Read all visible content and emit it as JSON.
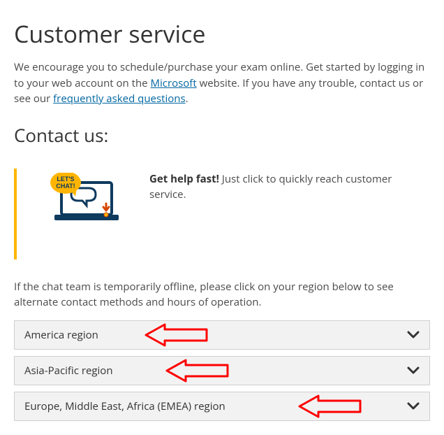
{
  "page": {
    "title": "Customer service",
    "intro_prefix": "We encourage you to schedule/purchase your exam online. Get started by logging in to your web account on the ",
    "intro_link1": "Microsoft",
    "intro_mid": " website. If you have any trouble, contact us or see our ",
    "intro_link2": "frequently asked questions",
    "intro_suffix": "."
  },
  "contact": {
    "heading": "Contact us:",
    "callout": {
      "bubble_text": "LET'S CHAT!",
      "bold": "Get help fast!",
      "rest": " Just click to quickly reach customer service."
    },
    "note": "If the chat team is temporarily offline, please click on your region below to see alternate contact methods and hours of operation.",
    "regions": [
      {
        "label": "America region"
      },
      {
        "label": "Asia-Pacific region"
      },
      {
        "label": "Europe, Middle East, Africa (EMEA) region"
      }
    ]
  },
  "annotations": {
    "arrow_color": "#ff0000"
  }
}
